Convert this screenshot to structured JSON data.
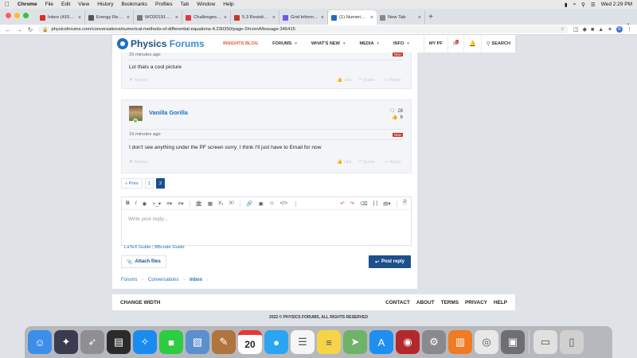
{
  "menubar": {
    "app": "Chrome",
    "items": [
      "File",
      "Edit",
      "View",
      "History",
      "Bookmarks",
      "Profiles",
      "Tab",
      "Window",
      "Help"
    ],
    "clock": "Wed 2:29 PM"
  },
  "tabs": [
    {
      "title": "Inbox (415) - robertvinu...",
      "color": "#d93025"
    },
    {
      "title": "Energy Renewal: Isotherm...",
      "color": "#555"
    },
    {
      "title": "WO2019136037A1.pdf",
      "color": "#777"
    },
    {
      "title": "Challenges to the 2nd La...",
      "color": "#e53935"
    },
    {
      "title": "5.3 Resistivity and Resist...",
      "color": "#c0392b"
    },
    {
      "title": "Grid Information",
      "color": "#6c5ce7"
    },
    {
      "title": "(1) Numerical Methods of...",
      "color": "#1d6fc1",
      "active": true
    },
    {
      "title": "New Tab",
      "color": "#888"
    }
  ],
  "address": "physicsforums.com/conversations/numerical-methods-of-differential-equations-4.230350/page-2#convMessage-345415",
  "site": {
    "logo_a": "Physics ",
    "logo_b": "Forums",
    "nav": [
      {
        "label": "INSIGHTS BLOG",
        "highlight": true
      },
      {
        "label": "FORUMS"
      },
      {
        "label": "WHAT'S NEW"
      },
      {
        "label": "MEDIA"
      },
      {
        "label": "INFO"
      }
    ],
    "mypf": "MY PF",
    "search": "SEARCH"
  },
  "post1": {
    "time": "20 minutes ago",
    "new_tag": "New",
    "text": "Lol thats a cool picture",
    "report": "Report",
    "like": "Like",
    "quote": "Quote",
    "reply": "Reply"
  },
  "post2": {
    "username": "Vanilla Gorilla",
    "messages": "28",
    "likes": "6",
    "time": "16 minutes ago",
    "new_tag": "New",
    "text": "I don't see anything under the PF screen sorry; I think I'll just have to Email for now",
    "report": "Report",
    "like": "Like",
    "quote": "Quote",
    "reply": "Reply"
  },
  "pager": {
    "prev": "« Prev",
    "pages": [
      "1",
      "2"
    ],
    "current": "2"
  },
  "editor": {
    "placeholder": "Write your reply..."
  },
  "guides": {
    "latex": "LaTeX Guide",
    "sep": "|",
    "bbcode": "BBcode Guide"
  },
  "buttons": {
    "attach": "Attach files",
    "post_reply": "Post reply"
  },
  "breadcrumb": [
    "Forums",
    "Conversations",
    "Inbox"
  ],
  "footer": {
    "change_width": "CHANGE WIDTH",
    "links": [
      "CONTACT",
      "ABOUT",
      "TERMS",
      "PRIVACY",
      "HELP"
    ],
    "copyright": "2022 © PHYSICS FORUMS, ALL RIGHTS RESERVED"
  },
  "dock": [
    {
      "name": "finder-icon",
      "color": "#3b8fe8"
    },
    {
      "name": "launchpad-icon",
      "color": "#3b3b4f"
    },
    {
      "name": "rocket-icon",
      "color": "#8e8e93"
    },
    {
      "name": "activity-monitor-icon",
      "color": "#2b2b2b"
    },
    {
      "name": "safari-icon",
      "color": "#1a8cf0"
    },
    {
      "name": "facetime-icon",
      "color": "#2ecc40"
    },
    {
      "name": "preview-icon",
      "color": "#5a8fd0"
    },
    {
      "name": "notebook-icon",
      "color": "#b0743d"
    },
    {
      "name": "calendar-icon",
      "color": "#ffffff"
    },
    {
      "name": "messages-icon",
      "color": "#2aa5f3"
    },
    {
      "name": "reminders-icon",
      "color": "#f5f5f5"
    },
    {
      "name": "notes-icon",
      "color": "#f5d547"
    },
    {
      "name": "maps-icon",
      "color": "#6fb36a"
    },
    {
      "name": "app-store-icon",
      "color": "#1f8ef1"
    },
    {
      "name": "photo-booth-icon",
      "color": "#b3282d"
    },
    {
      "name": "system-preferences-icon",
      "color": "#8a8a8e"
    },
    {
      "name": "books-icon",
      "color": "#f07b22"
    },
    {
      "name": "chrome-icon",
      "color": "#e8e8e8"
    },
    {
      "name": "screenshot-icon",
      "color": "#6e6e73"
    },
    {
      "name": "downloads-icon",
      "color": "#e0e0e0"
    },
    {
      "name": "trash-icon",
      "color": "#d0d0d0"
    }
  ],
  "calendar_day": "20",
  "colors": {
    "brand_dark": "#1d4f8c",
    "brand": "#1d6fc1",
    "accent": "#e25b2a",
    "new_tag": "#c2362b"
  }
}
